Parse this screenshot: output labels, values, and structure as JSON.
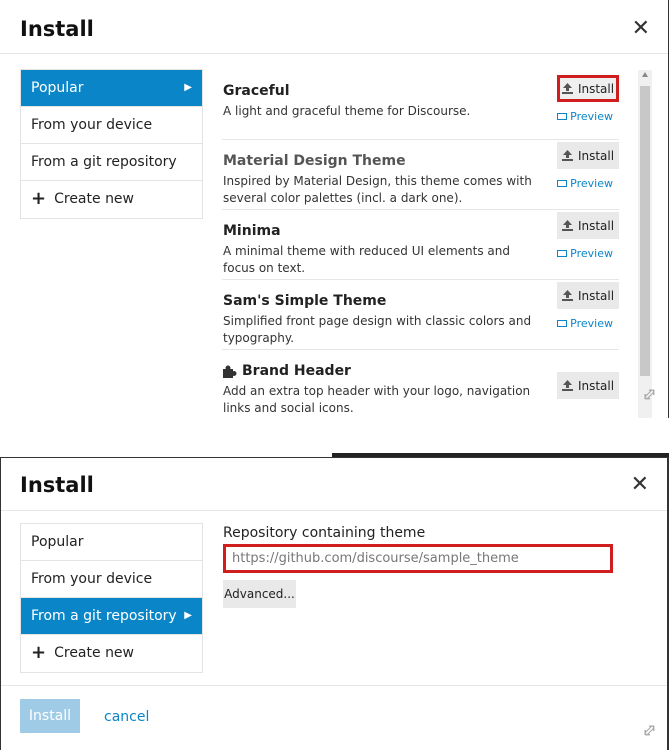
{
  "colors": {
    "accent": "#0a86c8",
    "highlight": "#d01e1e",
    "disabled_button": "#9fcbe6"
  },
  "top_modal": {
    "title": "Install",
    "close_glyph": "✕",
    "nav": [
      {
        "label": "Popular",
        "active": true
      },
      {
        "label": "From your device"
      },
      {
        "label": "From a git repository"
      },
      {
        "label": "Create new",
        "icon": "plus-icon"
      }
    ],
    "themes": [
      {
        "name": "Graceful",
        "desc": "A light and graceful theme for Discourse.",
        "install": "Install",
        "preview": "Preview"
      },
      {
        "name": "Material Design Theme",
        "desc": "Inspired by Material Design, this theme comes with several color palettes (incl. a dark one).",
        "install": "Install",
        "preview": "Preview"
      },
      {
        "name": "Minima",
        "desc": "A minimal theme with reduced UI elements and focus on text.",
        "install": "Install",
        "preview": "Preview"
      },
      {
        "name": "Sam's Simple Theme",
        "desc": "Simplified front page design with classic colors and typography.",
        "install": "Install",
        "preview": "Preview"
      },
      {
        "name": "Brand Header",
        "desc": "Add an extra top header with your logo, navigation links and social icons.",
        "install": "Install",
        "icon": "puzzle-icon"
      }
    ]
  },
  "bottom_modal": {
    "title": "Install",
    "close_glyph": "✕",
    "nav": [
      {
        "label": "Popular"
      },
      {
        "label": "From your device"
      },
      {
        "label": "From a git repository",
        "active": true
      },
      {
        "label": "Create new",
        "icon": "plus-icon"
      }
    ],
    "repo_label": "Repository containing theme",
    "repo_placeholder": "https://github.com/discourse/sample_theme",
    "advanced_label": "Advanced...",
    "install_label": "Install",
    "cancel_label": "cancel"
  }
}
